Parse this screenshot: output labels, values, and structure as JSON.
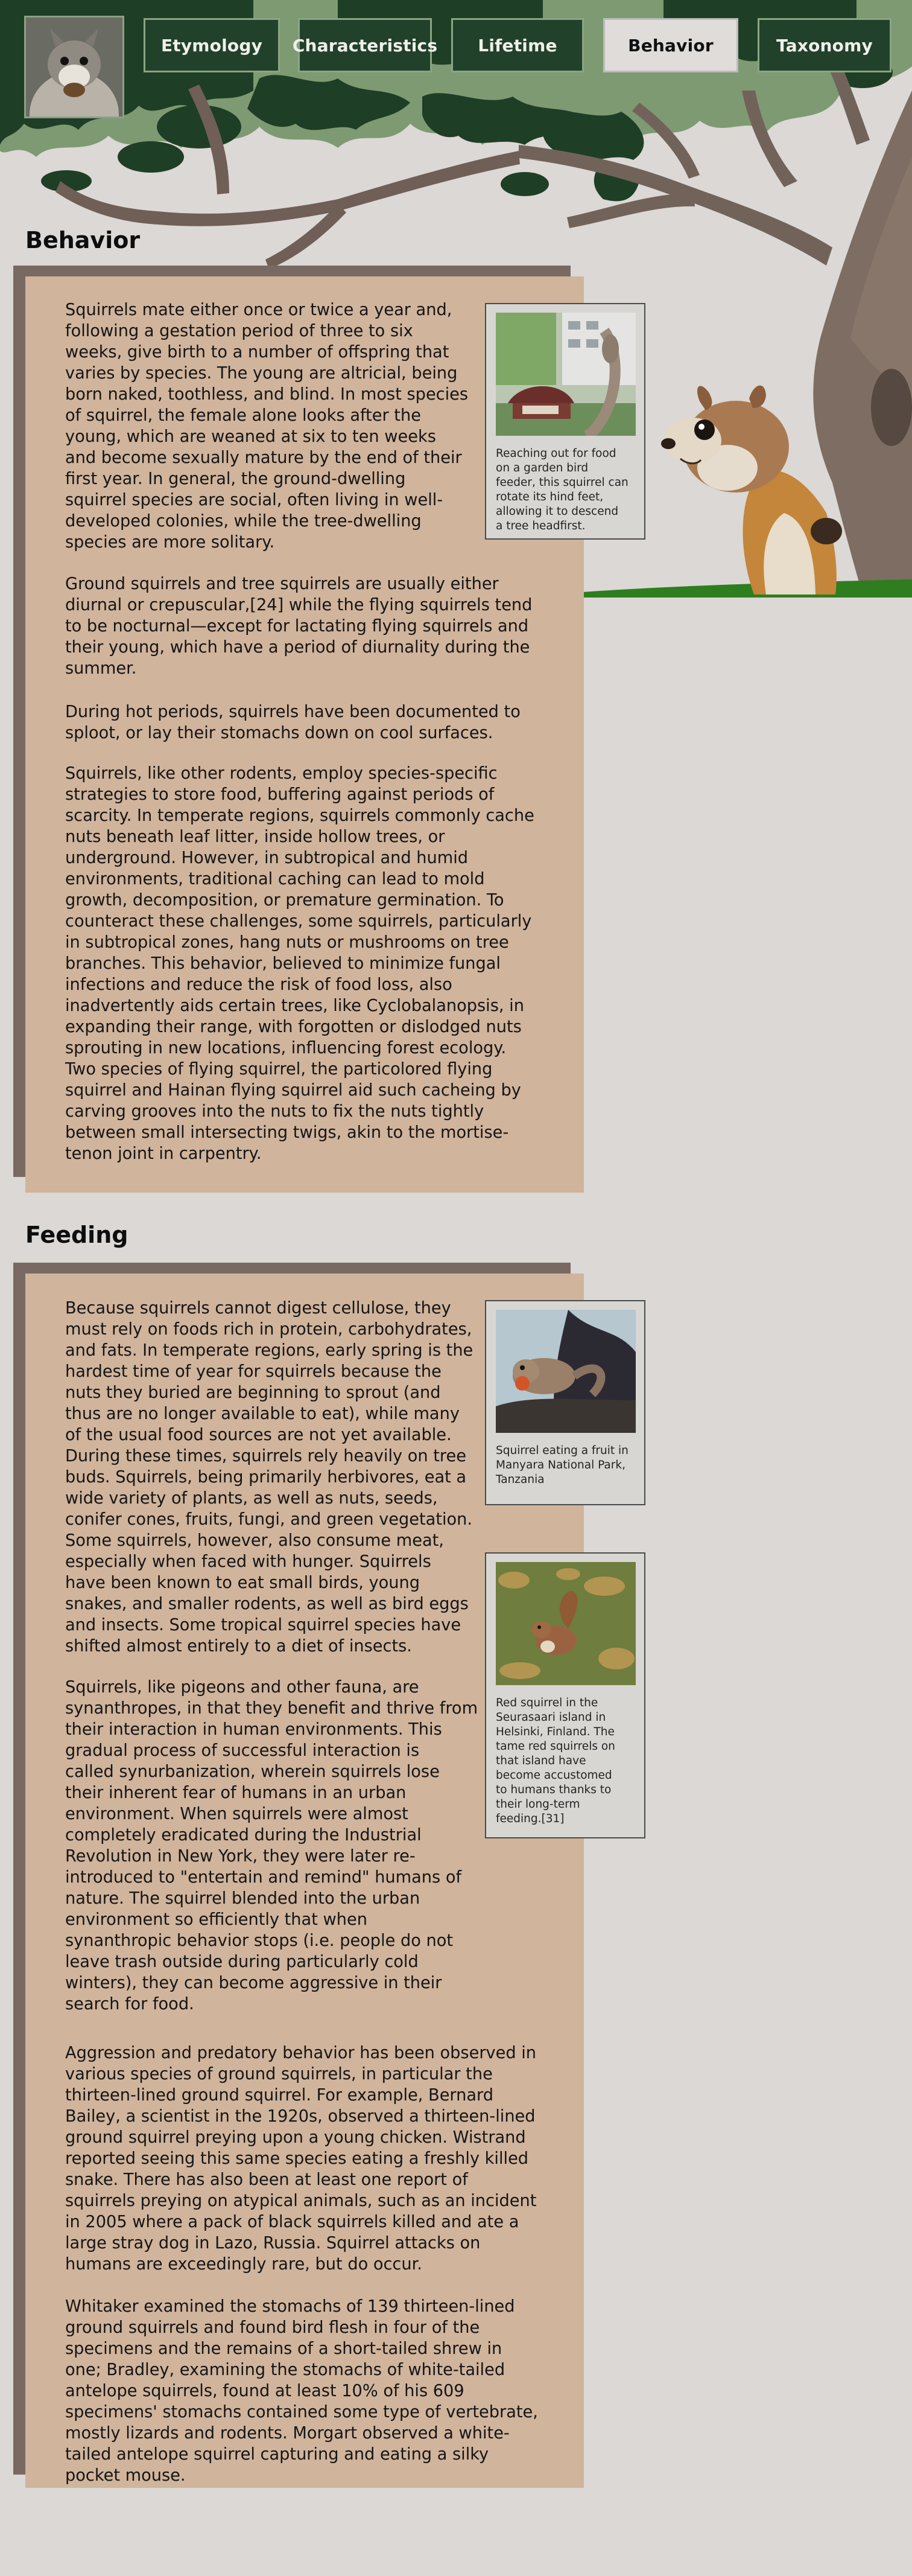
{
  "nav": {
    "avatar": "squirrel-portrait",
    "items": [
      {
        "label": "Etymology",
        "active": false
      },
      {
        "label": "Characteristics",
        "active": false
      },
      {
        "label": "Lifetime",
        "active": false
      },
      {
        "label": "Behavior",
        "active": true
      },
      {
        "label": "Taxonomy",
        "active": false
      }
    ]
  },
  "colors": {
    "nav_bg": "#22412a",
    "nav_border": "#8aa584",
    "panel": "#d0b49c",
    "panel_shadow": "#786a62",
    "page_bg": "#dbd8d5"
  },
  "behavior": {
    "heading": "Behavior",
    "paragraphs": [
      [
        "Squirrels mate either once or twice a year and,",
        "following a gestation period of three to six",
        "weeks, give birth to a number of offspring that",
        "varies by species. The young are altricial, being",
        "born naked, toothless, and blind. In most species",
        "of squirrel, the female alone looks after the",
        "young, which are weaned at six to ten weeks",
        "and become sexually mature by the end of their",
        "first year. In general, the ground-dwelling",
        "squirrel species are social, often living in well-",
        "developed colonies, while the tree-dwelling",
        "species are more solitary."
      ],
      [
        "Ground squirrels and tree squirrels are usually either",
        "diurnal or crepuscular,[24] while the flying squirrels tend",
        "to be nocturnal—except for lactating flying squirrels and",
        "their young, which have a period of diurnality during the",
        "summer."
      ],
      [
        "During hot periods, squirrels have been documented to",
        "sploot, or lay their stomachs down on cool surfaces."
      ],
      [
        "Squirrels, like other rodents, employ species-specific",
        "strategies to store food, buffering against periods of",
        "scarcity. In temperate regions, squirrels commonly cache",
        "nuts beneath leaf litter, inside hollow trees, or",
        "underground. However, in subtropical and humid",
        "environments, traditional caching can lead to mold",
        "growth, decomposition, or premature germination. To",
        "counteract these challenges, some squirrels, particularly",
        "in subtropical zones, hang nuts or mushrooms on tree",
        "branches. This behavior, believed to minimize fungal",
        "infections and reduce the risk of food loss, also",
        "inadvertently aids certain trees, like Cyclobalanopsis, in",
        "expanding their range, with forgotten or dislodged nuts",
        "sprouting in new locations, influencing forest ecology.",
        "Two species of flying squirrel, the particolored flying",
        "squirrel and Hainan flying squirrel aid such cacheing by",
        "carving grooves into the nuts to fix the nuts tightly",
        "between small intersecting twigs, akin to the mortise-",
        "tenon joint in carpentry."
      ]
    ],
    "figure": {
      "caption": [
        "Reaching out for food",
        "on a garden bird",
        "feeder, this squirrel can",
        "rotate its hind feet,",
        "allowing it to descend",
        "a tree headfirst."
      ]
    }
  },
  "feeding": {
    "heading": "Feeding",
    "paragraphs": [
      [
        "Because squirrels cannot digest cellulose, they",
        "must rely on foods rich in protein, carbohydrates,",
        "and fats. In temperate regions, early spring is the",
        "hardest time of year for squirrels because the",
        "nuts they buried are beginning to sprout (and",
        "thus are no longer available to eat), while many",
        "of the usual food sources are not yet available.",
        "During these times, squirrels rely heavily on tree",
        "buds. Squirrels, being primarily herbivores, eat a",
        "wide variety of plants, as well as nuts, seeds,",
        "conifer cones, fruits, fungi, and green vegetation.",
        "Some squirrels, however, also consume meat,",
        "especially when faced with hunger. Squirrels",
        "have been known to eat small birds, young",
        "snakes, and smaller rodents, as well as bird eggs",
        "and insects. Some tropical squirrel species have",
        "shifted almost entirely to a diet of insects."
      ],
      [
        "Squirrels, like pigeons and other fauna, are",
        "synanthropes, in that they benefit and thrive from",
        "their interaction in human environments. This",
        "gradual process of successful interaction is",
        "called synurbanization, wherein squirrels lose",
        "their inherent fear of humans in an urban",
        "environment. When squirrels were almost",
        "completely eradicated during the Industrial",
        "Revolution in New York, they were later re-",
        "introduced to \"entertain and remind\" humans of",
        "nature. The squirrel blended into the urban",
        "environment so efficiently that when",
        "synanthropic behavior stops (i.e. people do not",
        "leave trash outside during particularly cold",
        "winters), they can become aggressive in their",
        "search for food."
      ],
      [
        "Aggression and predatory behavior has been observed in",
        "various species of ground squirrels, in particular the",
        "thirteen-lined ground squirrel. For example, Bernard",
        "Bailey, a scientist in the 1920s, observed a thirteen-lined",
        "ground squirrel preying upon a young chicken. Wistrand",
        "reported seeing this same species eating a freshly killed",
        "snake. There has also been at least one report of",
        "squirrels preying on atypical animals, such as an incident",
        "in 2005 where a pack of black squirrels killed and ate a",
        "large stray dog in Lazo, Russia. Squirrel attacks on",
        "humans are exceedingly rare, but do occur."
      ],
      [
        "Whitaker examined the stomachs of 139 thirteen-lined",
        "ground squirrels and found bird flesh in four of the",
        "specimens and the remains of a short-tailed shrew in",
        "one; Bradley, examining the stomachs of white-tailed",
        "antelope squirrels, found at least 10% of his 609",
        "specimens' stomachs contained some type of vertebrate,",
        "mostly lizards and rodents. Morgart observed a white-",
        "tailed antelope squirrel capturing and eating a silky",
        "pocket mouse."
      ]
    ],
    "figures": [
      {
        "caption": [
          "Squirrel eating a fruit in",
          "Manyara National Park,",
          "Tanzania"
        ]
      },
      {
        "caption": [
          "Red squirrel in the",
          "Seurasaari island in",
          "Helsinki, Finland. The",
          "tame red squirrels on",
          "that island have",
          "become accustomed",
          "to humans thanks to",
          "their long-term",
          "feeding.[31]"
        ]
      }
    ]
  }
}
